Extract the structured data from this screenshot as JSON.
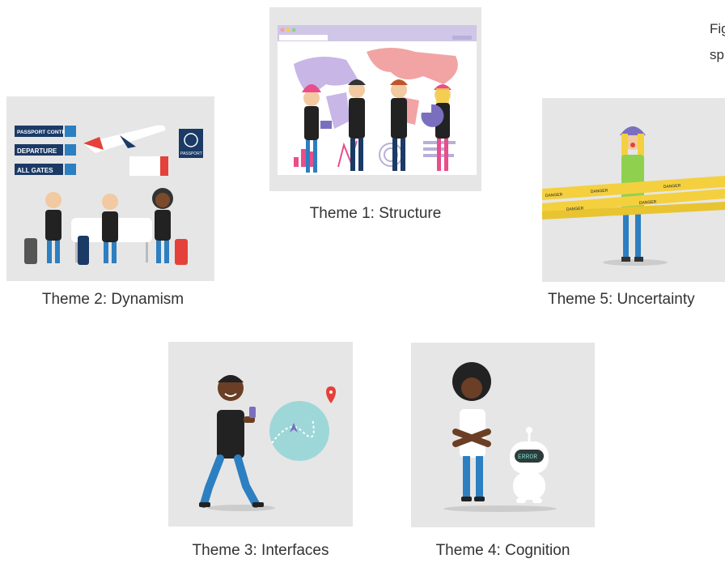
{
  "corner_text": {
    "line1": "Fig",
    "line2": "sp"
  },
  "themes": [
    {
      "label": "Theme 1: Structure",
      "illustration": "people-at-world-map-dashboard"
    },
    {
      "label": "Theme 2: Dynamism",
      "illustration": "travelers-at-airport"
    },
    {
      "label": "Theme 3: Interfaces",
      "illustration": "man-walking-with-phone-map"
    },
    {
      "label": "Theme 4: Cognition",
      "illustration": "confused-woman-with-error-robot"
    },
    {
      "label": "Theme 5: Uncertainty",
      "illustration": "worker-behind-danger-tape"
    }
  ],
  "signage": {
    "passport_control": "PASSPORT CONTROL",
    "departure": "DEPARTURE",
    "all_gates": "ALL GATES",
    "passport": "PASSPORT",
    "robot_screen": "ERROR",
    "tape": "DANGER"
  },
  "colors": {
    "panel_bg": "#e6e6e6",
    "navy": "#1b3a66",
    "pink": "#e94d8a",
    "yellow": "#f4d03f",
    "blue": "#2c7fc1",
    "teal": "#9ed7d8",
    "red": "#e4413a"
  }
}
